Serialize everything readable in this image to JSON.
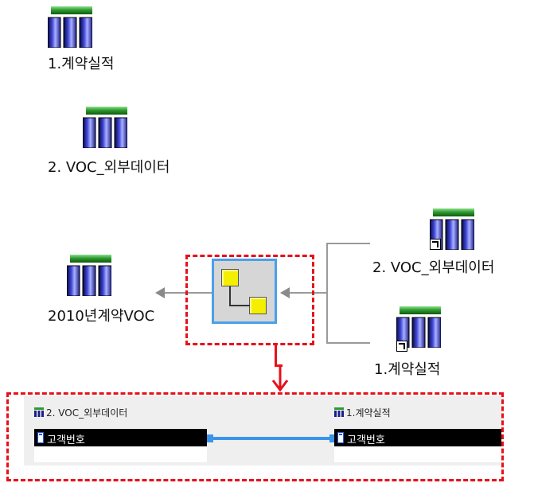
{
  "canvas": {
    "nodes": {
      "contract_top": "1.계약실적",
      "voc_top": "2. VOC_외부데이터",
      "output": "2010년계약VOC",
      "voc_input": "2. VOC_외부데이터",
      "contract_input": "1.계약실적"
    }
  },
  "join_panel": {
    "left_table_title": "2. VOC_외부데이터",
    "right_table_title": "1.계약실적",
    "left_key": "고객번호",
    "right_key": "고객번호"
  },
  "colors": {
    "accent_blue": "#4aa0ea",
    "highlight_red": "#e8101a",
    "merge_yellow": "#f4ee00",
    "table_header_green": "#2e9b2e",
    "table_columns_navy": "#1b1f8a"
  },
  "icons": [
    "table-icon",
    "shortcut-icon",
    "merge-icon",
    "arrow-left-icon",
    "column-icon"
  ]
}
